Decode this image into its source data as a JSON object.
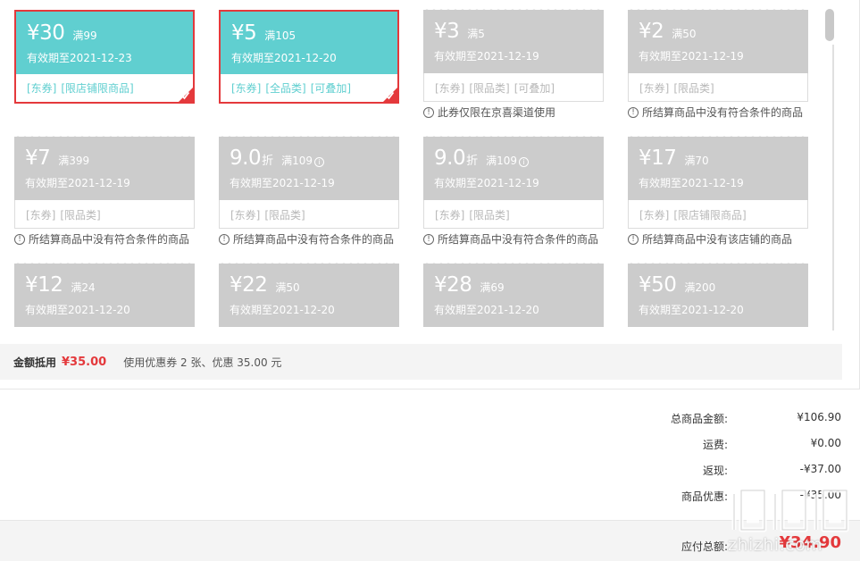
{
  "coupons": [
    {
      "style": "teal",
      "value": "¥30",
      "unit": "",
      "cond": "满99",
      "info": false,
      "validity": "有效期至2021-12-23",
      "tags": [
        "[东券]",
        "[限店铺限商品]"
      ],
      "selected": true,
      "reason": ""
    },
    {
      "style": "teal",
      "value": "¥5",
      "unit": "",
      "cond": "满105",
      "info": false,
      "validity": "有效期至2021-12-20",
      "tags": [
        "[东券]",
        "[全品类]",
        "[可叠加]"
      ],
      "selected": true,
      "reason": ""
    },
    {
      "style": "gray",
      "value": "¥3",
      "unit": "",
      "cond": "满5",
      "info": false,
      "validity": "有效期至2021-12-19",
      "tags": [
        "[东券]",
        "[限品类]",
        "[可叠加]"
      ],
      "selected": false,
      "reason": "此券仅限在京喜渠道使用"
    },
    {
      "style": "gray",
      "value": "¥2",
      "unit": "",
      "cond": "满50",
      "info": false,
      "validity": "有效期至2021-12-19",
      "tags": [
        "[东券]",
        "[限品类]"
      ],
      "selected": false,
      "reason": "所结算商品中没有符合条件的商品"
    },
    {
      "style": "gray",
      "value": "¥7",
      "unit": "",
      "cond": "满399",
      "info": false,
      "validity": "有效期至2021-12-19",
      "tags": [
        "[东券]",
        "[限品类]"
      ],
      "selected": false,
      "reason": "所结算商品中没有符合条件的商品"
    },
    {
      "style": "gray",
      "value": "9.0",
      "unit": "折",
      "cond": "满109",
      "info": true,
      "validity": "有效期至2021-12-19",
      "tags": [
        "[东券]",
        "[限品类]"
      ],
      "selected": false,
      "reason": "所结算商品中没有符合条件的商品"
    },
    {
      "style": "gray",
      "value": "9.0",
      "unit": "折",
      "cond": "满109",
      "info": true,
      "validity": "有效期至2021-12-19",
      "tags": [
        "[东券]",
        "[限品类]"
      ],
      "selected": false,
      "reason": "所结算商品中没有符合条件的商品"
    },
    {
      "style": "gray",
      "value": "¥17",
      "unit": "",
      "cond": "满70",
      "info": false,
      "validity": "有效期至2021-12-19",
      "tags": [
        "[东券]",
        "[限店铺限商品]"
      ],
      "selected": false,
      "reason": "所结算商品中没有该店铺的商品"
    },
    {
      "style": "gray",
      "value": "¥12",
      "unit": "",
      "cond": "满24",
      "info": false,
      "validity": "有效期至2021-12-20",
      "tags": [],
      "selected": false,
      "reason": ""
    },
    {
      "style": "gray",
      "value": "¥22",
      "unit": "",
      "cond": "满50",
      "info": false,
      "validity": "有效期至2021-12-20",
      "tags": [],
      "selected": false,
      "reason": ""
    },
    {
      "style": "gray",
      "value": "¥28",
      "unit": "",
      "cond": "满69",
      "info": false,
      "validity": "有效期至2021-12-20",
      "tags": [],
      "selected": false,
      "reason": ""
    },
    {
      "style": "gray",
      "value": "¥50",
      "unit": "",
      "cond": "满200",
      "info": false,
      "validity": "有效期至2021-12-20",
      "tags": [],
      "selected": false,
      "reason": ""
    }
  ],
  "summary": {
    "label": "金额抵用",
    "amount": "¥35.00",
    "desc": "使用优惠券 2 张、优惠 35.00 元"
  },
  "totals": [
    {
      "label": "总商品金额:",
      "value": "¥106.90"
    },
    {
      "label": "运费:",
      "value": "¥0.00"
    },
    {
      "label": "返现:",
      "value": "-¥37.00"
    },
    {
      "label": "商品优惠:",
      "value": "-¥35.00"
    }
  ],
  "payment": {
    "label": "应付总额:",
    "amount": "¥34.90"
  },
  "watermark": {
    "text": "zhizhi.com"
  },
  "colors": {
    "teal": "#60cfd0",
    "gray": "#cccccc",
    "red": "#e4393c"
  }
}
